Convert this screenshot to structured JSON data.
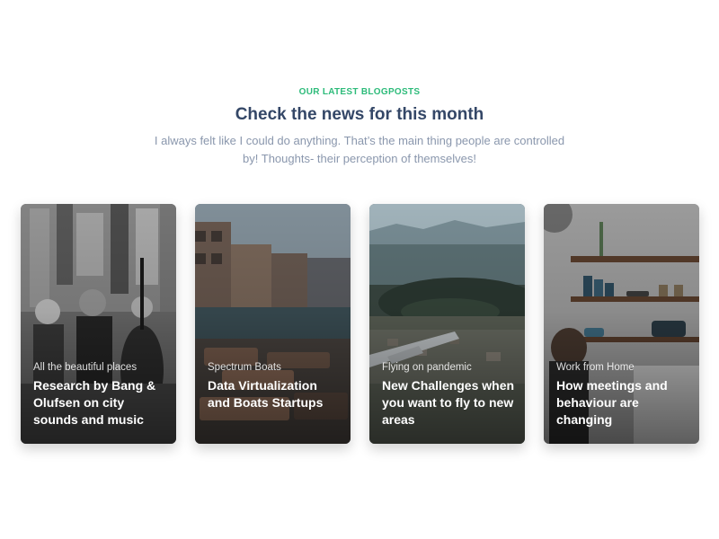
{
  "header": {
    "eyebrow": "OUR LATEST BLOGPOSTS",
    "title": "Check the news for this month",
    "lead": "I always felt like I could do anything. That’s the main thing people are controlled by! Thoughts- their perception of themselves!"
  },
  "cards": [
    {
      "category": "All the beautiful places",
      "title": "Research by Bang & Olufsen on city sounds and music",
      "image": "street-musician-photo"
    },
    {
      "category": "Spectrum Boats",
      "title": "Data Virtualization and Boats Startups",
      "image": "venice-canal-photo"
    },
    {
      "category": "Flying on pandemic",
      "title": "New Challenges when you want to fly to new areas",
      "image": "aerial-city-photo"
    },
    {
      "category": "Work from Home",
      "title": "How meetings and behaviour are changing",
      "image": "kitchen-shelves-photo"
    }
  ],
  "colors": {
    "accent": "#2dbb7a",
    "heading": "#344767",
    "muted": "#8a97ad"
  }
}
